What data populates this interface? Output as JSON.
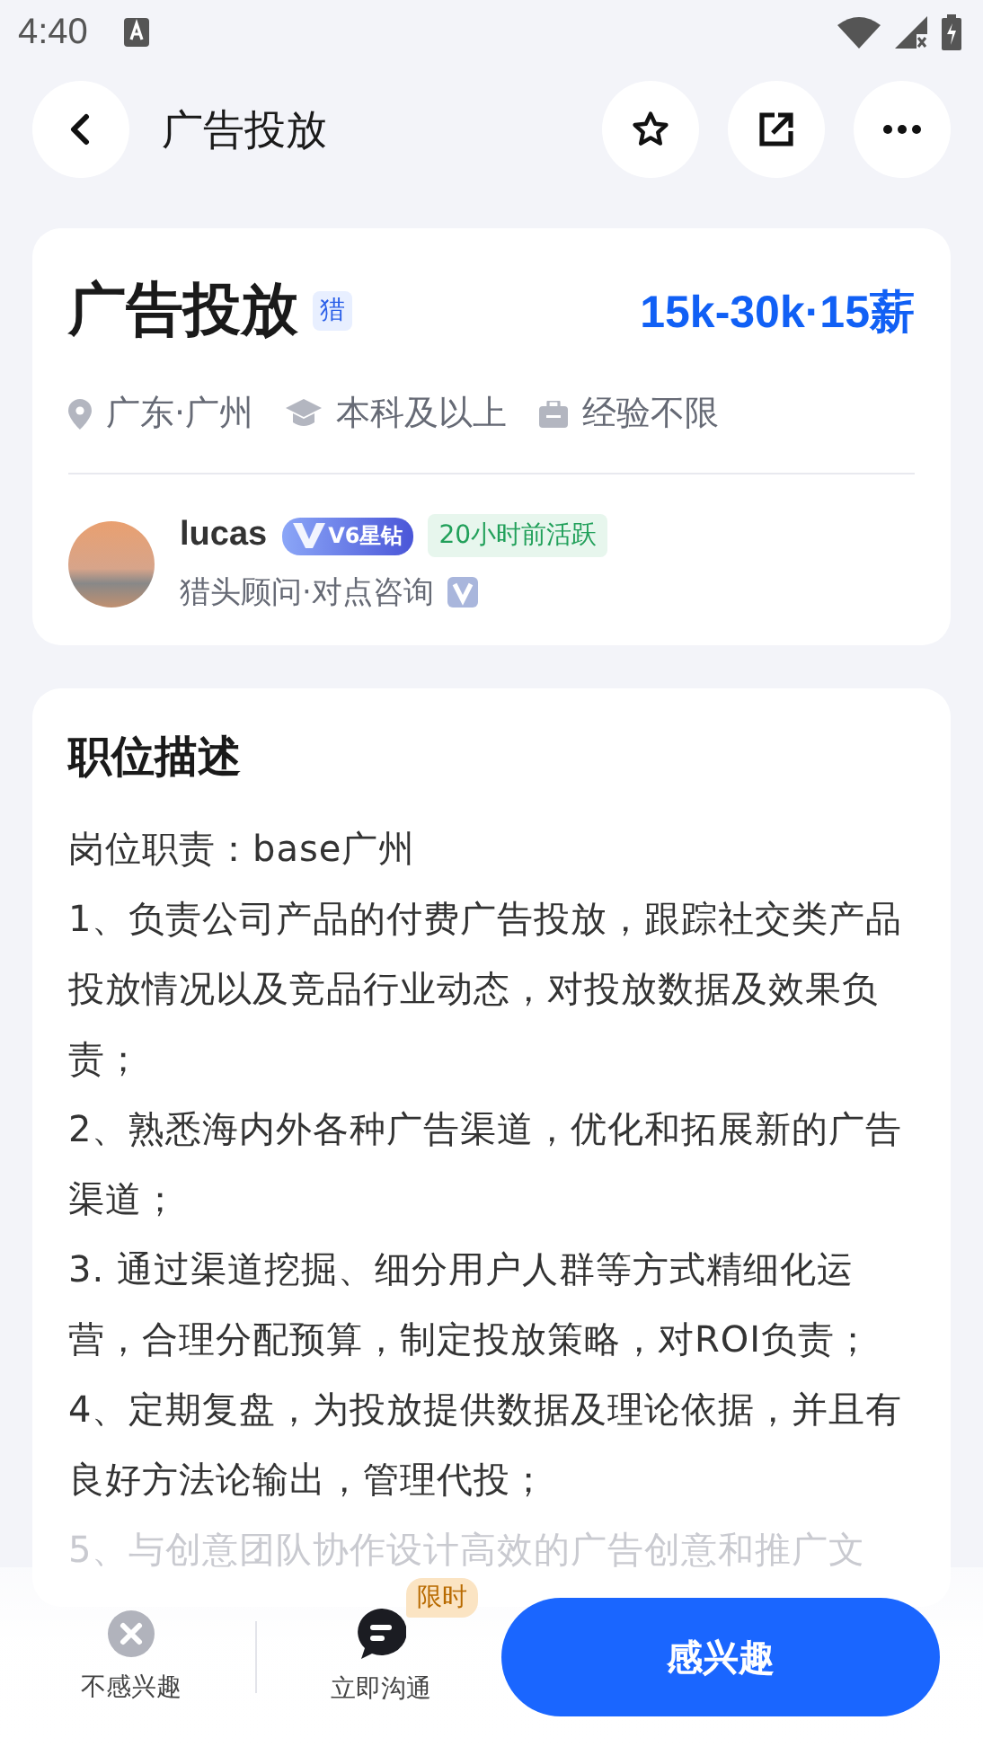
{
  "status_bar": {
    "time": "4:40"
  },
  "header": {
    "title": "广告投放"
  },
  "job": {
    "title": "广告投放",
    "tag": "猎",
    "salary": "15k-30k·15薪",
    "requirements": [
      {
        "kind": "location",
        "text": "广东·广州"
      },
      {
        "kind": "education",
        "text": "本科及以上"
      },
      {
        "kind": "experience",
        "text": "经验不限"
      }
    ]
  },
  "recruiter": {
    "name": "lucas",
    "level_badge": "V6星钻",
    "activity": "20小时前活跃",
    "title": "猎头顾问·对点咨询",
    "verified": true
  },
  "description": {
    "heading": "职位描述",
    "paragraphs": [
      "岗位职责：base广州",
      "1、负责公司产品的付费广告投放，跟踪社交类产品投放情况以及竞品行业动态，对投放数据及效果负责；",
      "2、熟悉海内外各种广告渠道，优化和拓展新的广告渠道；",
      "3. 通过渠道挖掘、细分用户人群等方式精细化运营，合理分配预算，制定投放策略，对ROI负责；",
      "4、定期复盘，为投放提供数据及理论依据，并且有良好方法论输出，管理代投；",
      "5、与创意团队协作设计高效的广告创意和推广文"
    ]
  },
  "bottom_bar": {
    "dismiss": "不感兴趣",
    "chat": "立即沟通",
    "chat_badge": "限时",
    "primary": "感兴趣"
  }
}
